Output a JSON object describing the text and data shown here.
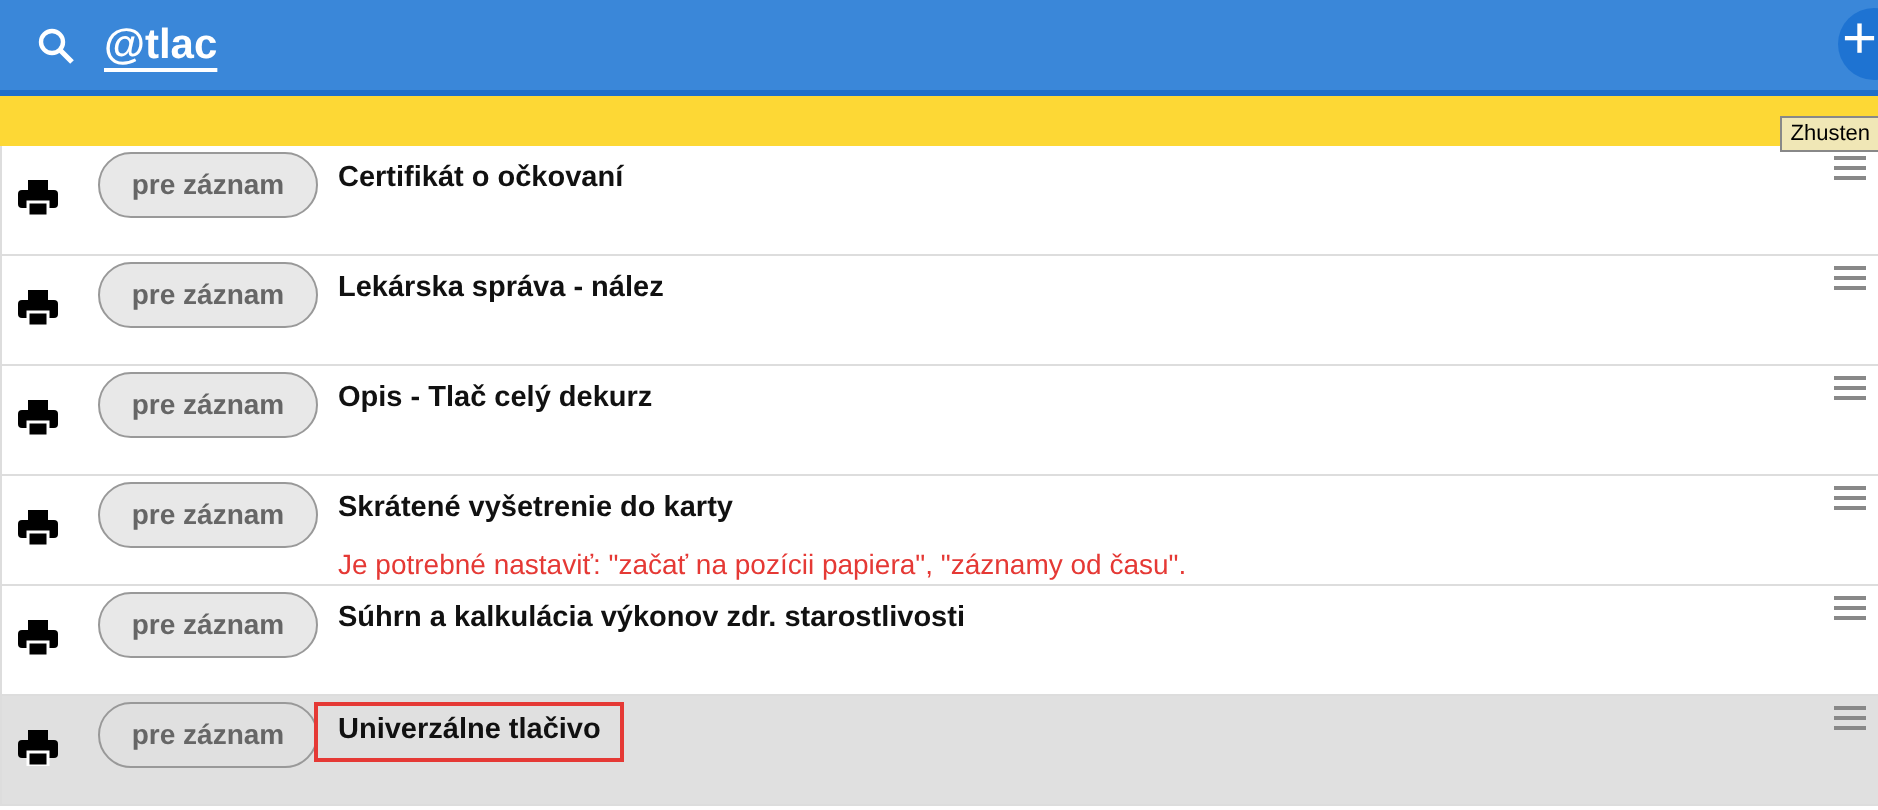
{
  "search": {
    "value": "@tlac"
  },
  "add_button": {
    "label": "+"
  },
  "toolbar": {
    "button": "Zhusten"
  },
  "rows": [
    {
      "badge": "pre záznam",
      "title": "Certifikát o očkovaní",
      "selected": false,
      "highlighted": false
    },
    {
      "badge": "pre záznam",
      "title": "Lekárska správa - nález",
      "selected": false,
      "highlighted": false
    },
    {
      "badge": "pre záznam",
      "title": "Opis - Tlač celý dekurz",
      "selected": false,
      "highlighted": false
    },
    {
      "badge": "pre záznam",
      "title": "Skrátené vyšetrenie do karty",
      "warning": "Je potrebné nastaviť: \"začať na pozícii papiera\", \"záznamy od času\".",
      "selected": false,
      "highlighted": false
    },
    {
      "badge": "pre záznam",
      "title": "Súhrn a kalkulácia výkonov zdr. starostlivosti",
      "selected": false,
      "highlighted": false
    },
    {
      "badge": "pre záznam",
      "title": "Univerzálne tlačivo",
      "selected": true,
      "highlighted": true
    }
  ]
}
